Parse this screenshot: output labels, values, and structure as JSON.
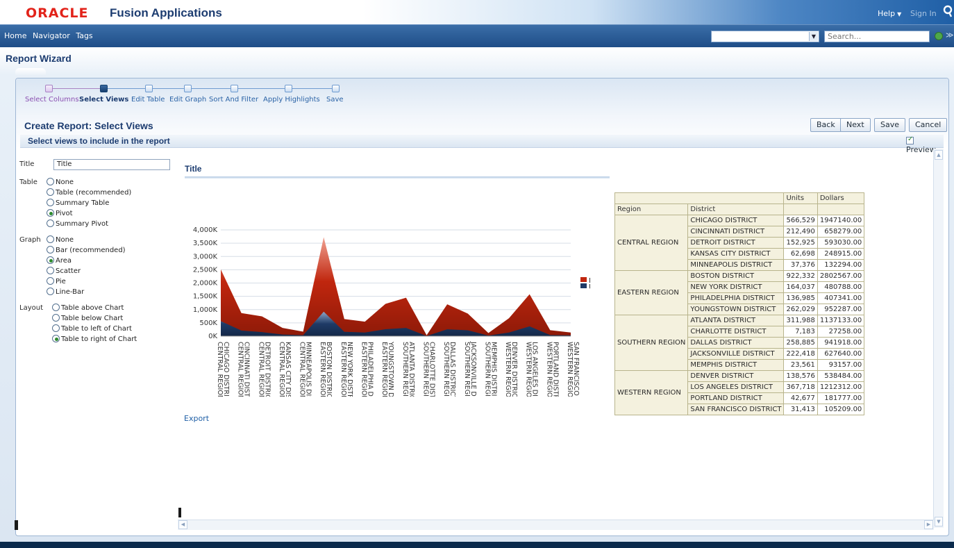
{
  "brand": {
    "logo": "ORACLE",
    "product": "Fusion Applications",
    "help": "Help",
    "sign_in": "Sign In"
  },
  "nav": {
    "links": [
      "Home",
      "Navigator",
      "Tags"
    ],
    "search_placeholder": "Search...",
    "dropdown_value": ""
  },
  "page": {
    "title": "Report Wizard",
    "subtitle": "Create Report: Select Views",
    "section": "Select views to include in the report",
    "preview_label": "Preview",
    "buttons": {
      "back": "Back",
      "next": "Next",
      "save": "Save",
      "cancel": "Cancel"
    }
  },
  "train": [
    {
      "label": "Select Columns",
      "state": "visited"
    },
    {
      "label": "Select Views",
      "state": "current"
    },
    {
      "label": "Edit Table",
      "state": "unvisited"
    },
    {
      "label": "Edit Graph",
      "state": "unvisited"
    },
    {
      "label": "Sort And Filter",
      "state": "unvisited"
    },
    {
      "label": "Apply Highlights",
      "state": "unvisited"
    },
    {
      "label": "Save",
      "state": "unvisited"
    }
  ],
  "form": {
    "title_label": "Title",
    "title_value": "Title",
    "table_label": "Table",
    "table_options": [
      "None",
      "Table (recommended)",
      "Summary Table",
      "Pivot",
      "Summary Pivot"
    ],
    "table_selected": "Pivot",
    "graph_label": "Graph",
    "graph_options": [
      "None",
      "Bar (recommended)",
      "Area",
      "Scatter",
      "Pie",
      "Line-Bar"
    ],
    "graph_selected": "Area",
    "layout_label": "Layout",
    "layout_options": [
      "Table above Chart",
      "Table below Chart",
      "Table to left of Chart",
      "Table to right of Chart"
    ],
    "layout_selected": "Table to right of Chart"
  },
  "chart_title": "Title",
  "export_label": "Export",
  "colors": {
    "dollars": "#c0260e",
    "units": "#1e3a66",
    "accent": "#1c3c70"
  },
  "chart_data": {
    "type": "area",
    "title": "Title",
    "ylim": [
      0,
      4000000
    ],
    "yticks": [
      "0K",
      "500K",
      "1,000K",
      "1,500K",
      "2,000K",
      "2,500K",
      "3,000K",
      "3,500K",
      "4,000K"
    ],
    "legend_position": "right",
    "categories": [
      "CENTRAL REGION CHICAGO DISTRICT",
      "CENTRAL REGION CINCINNATI DISTRICT",
      "CENTRAL REGION DETROIT DISTRICT",
      "CENTRAL REGION KANSAS CITY DISTRICT",
      "CENTRAL REGION MINNEAPOLIS DISTRICT",
      "EASTERN REGION BOSTON DISTRICT",
      "EASTERN REGION NEW YORK DISTRICT",
      "EASTERN REGION PHILADELPHIA DISTRICT",
      "EASTERN REGION YOUNGSTOWN DISTRICT",
      "SOUTHERN REGION ATLANTA DISTRICT",
      "SOUTHERN REGION CHARLOTTE DISTRICT",
      "SOUTHERN REGION DALLAS DISTRICT",
      "SOUTHERN REGION JACKSONVILLE DISTRICT",
      "SOUTHERN REGION MEMPHIS DISTRICT",
      "WESTERN REGION DENVER DISTRICT",
      "WESTERN REGION LOS ANGELES DISTRICT",
      "WESTERN REGION PORTLAND DISTRICT",
      "WESTERN REGION SAN FRANCISCO DISTRICT"
    ],
    "series": [
      {
        "name": "Dollars",
        "values": [
          1947140,
          658279,
          593030,
          248915,
          132294,
          2802567,
          480788,
          407341,
          952287,
          1137133,
          27258,
          941918,
          627640,
          93157,
          538484,
          1212312,
          181777,
          105209
        ]
      },
      {
        "name": "Units",
        "values": [
          566529,
          212490,
          152925,
          62698,
          37376,
          922332,
          164037,
          136985,
          262029,
          311988,
          7183,
          258885,
          222418,
          23561,
          138576,
          367718,
          42677,
          31413
        ]
      }
    ]
  },
  "pivot": {
    "col_headers": [
      "Units",
      "Dollars"
    ],
    "row_headers": [
      "Region",
      "District"
    ],
    "regions": [
      {
        "name": "CENTRAL REGION",
        "rows": [
          {
            "district": "CHICAGO DISTRICT",
            "units": "566,529",
            "dollars": "1947140.00"
          },
          {
            "district": "CINCINNATI DISTRICT",
            "units": "212,490",
            "dollars": "658279.00"
          },
          {
            "district": "DETROIT DISTRICT",
            "units": "152,925",
            "dollars": "593030.00"
          },
          {
            "district": "KANSAS CITY DISTRICT",
            "units": "62,698",
            "dollars": "248915.00"
          },
          {
            "district": "MINNEAPOLIS DISTRICT",
            "units": "37,376",
            "dollars": "132294.00"
          }
        ]
      },
      {
        "name": "EASTERN REGION",
        "rows": [
          {
            "district": "BOSTON DISTRICT",
            "units": "922,332",
            "dollars": "2802567.00"
          },
          {
            "district": "NEW YORK DISTRICT",
            "units": "164,037",
            "dollars": "480788.00"
          },
          {
            "district": "PHILADELPHIA DISTRICT",
            "units": "136,985",
            "dollars": "407341.00"
          },
          {
            "district": "YOUNGSTOWN DISTRICT",
            "units": "262,029",
            "dollars": "952287.00"
          }
        ]
      },
      {
        "name": "SOUTHERN REGION",
        "rows": [
          {
            "district": "ATLANTA DISTRICT",
            "units": "311,988",
            "dollars": "1137133.00"
          },
          {
            "district": "CHARLOTTE DISTRICT",
            "units": "7,183",
            "dollars": "27258.00"
          },
          {
            "district": "DALLAS DISTRICT",
            "units": "258,885",
            "dollars": "941918.00"
          },
          {
            "district": "JACKSONVILLE DISTRICT",
            "units": "222,418",
            "dollars": "627640.00"
          },
          {
            "district": "MEMPHIS DISTRICT",
            "units": "23,561",
            "dollars": "93157.00"
          }
        ]
      },
      {
        "name": "WESTERN REGION",
        "rows": [
          {
            "district": "DENVER DISTRICT",
            "units": "138,576",
            "dollars": "538484.00"
          },
          {
            "district": "LOS ANGELES DISTRICT",
            "units": "367,718",
            "dollars": "1212312.00"
          },
          {
            "district": "PORTLAND DISTRICT",
            "units": "42,677",
            "dollars": "181777.00"
          },
          {
            "district": "SAN FRANCISCO DISTRICT",
            "units": "31,413",
            "dollars": "105209.00"
          }
        ]
      }
    ]
  }
}
